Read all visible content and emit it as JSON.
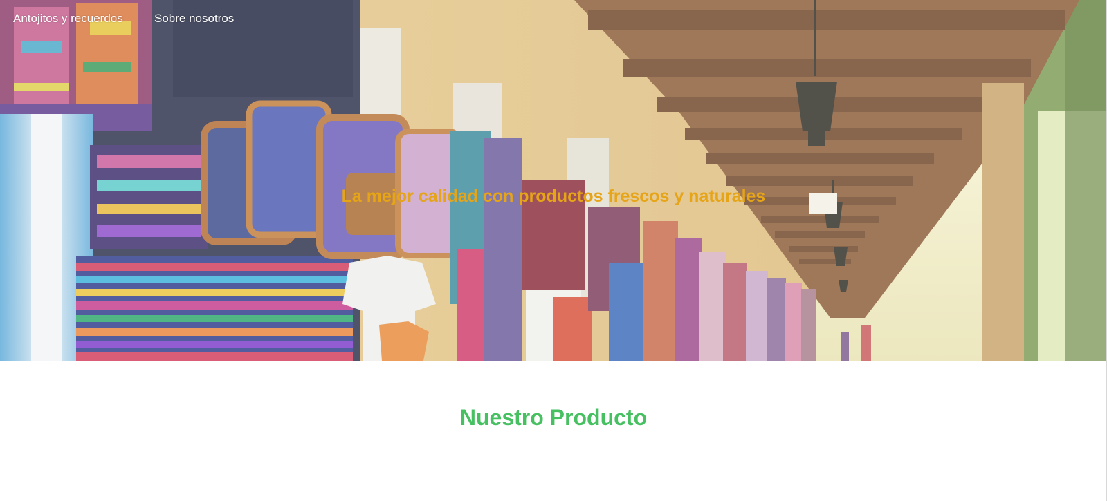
{
  "nav": {
    "items": [
      {
        "label": "Antojitos y recuerdos"
      },
      {
        "label": "Sobre nosotros"
      }
    ]
  },
  "hero": {
    "tagline": "La mejor calidad con productos frescos y naturales",
    "image": "market-arcade-photo"
  },
  "main": {
    "section_title": "Nuestro Producto"
  },
  "colors": {
    "tagline": "#e6a417",
    "section_title": "#46c060",
    "nav_text": "#ffffff"
  }
}
